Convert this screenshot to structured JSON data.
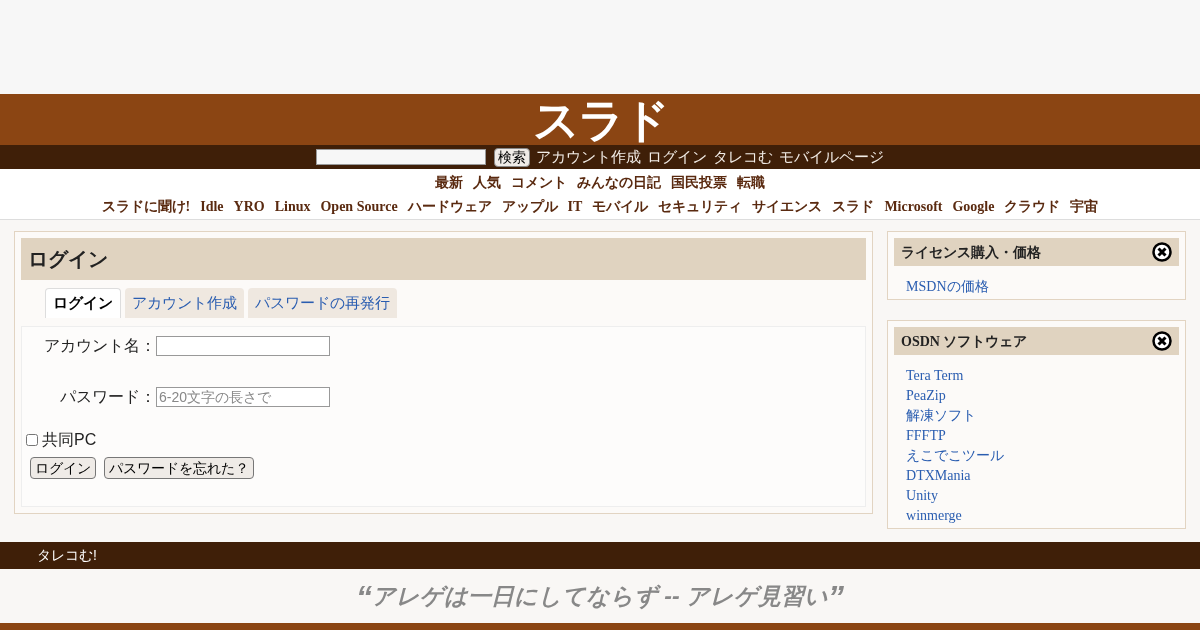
{
  "logo": "スラド",
  "search": {
    "button": "検索"
  },
  "top_links": [
    "アカウント作成",
    "ログイン",
    "タレコむ",
    "モバイルページ"
  ],
  "nav_primary": [
    "最新",
    "人気",
    "コメント",
    "みんなの日記",
    "国民投票",
    "転職"
  ],
  "nav_sections": [
    "スラドに聞け!",
    "Idle",
    "YRO",
    "Linux",
    "Open Source",
    "ハードウェア",
    "アップル",
    "IT",
    "モバイル",
    "セキュリティ",
    "サイエンス",
    "スラド",
    "Microsoft",
    "Google",
    "クラウド",
    "宇宙"
  ],
  "login": {
    "title": "ログイン",
    "tabs": [
      {
        "label": "ログイン",
        "selected": true
      },
      {
        "label": "アカウント作成",
        "selected": false
      },
      {
        "label": "パスワードの再発行",
        "selected": false
      }
    ],
    "fields": [
      {
        "label": "アカウント名："
      },
      {
        "label": "パスワード：",
        "placeholder": "6-20文字の長さで"
      }
    ],
    "shared_pc": {
      "label": "共同PC",
      "checked": false
    },
    "buttons": [
      "ログイン",
      "パスワードを忘れた？"
    ]
  },
  "sidebar": [
    {
      "title": "ライセンス購入・価格",
      "links": [
        "MSDNの価格"
      ]
    },
    {
      "title": "OSDN ソフトウェア",
      "links": [
        "Tera Term",
        "PeaZip",
        "解凍ソフト",
        "FFFTP",
        "えこでこツール",
        "DTXMania",
        "Unity",
        "winmerge"
      ]
    }
  ],
  "footer_bar": "タレコむ!",
  "quote": {
    "open": "“",
    "text": "アレゲは一日にしてならず -- アレゲ見習い",
    "close": "”"
  }
}
